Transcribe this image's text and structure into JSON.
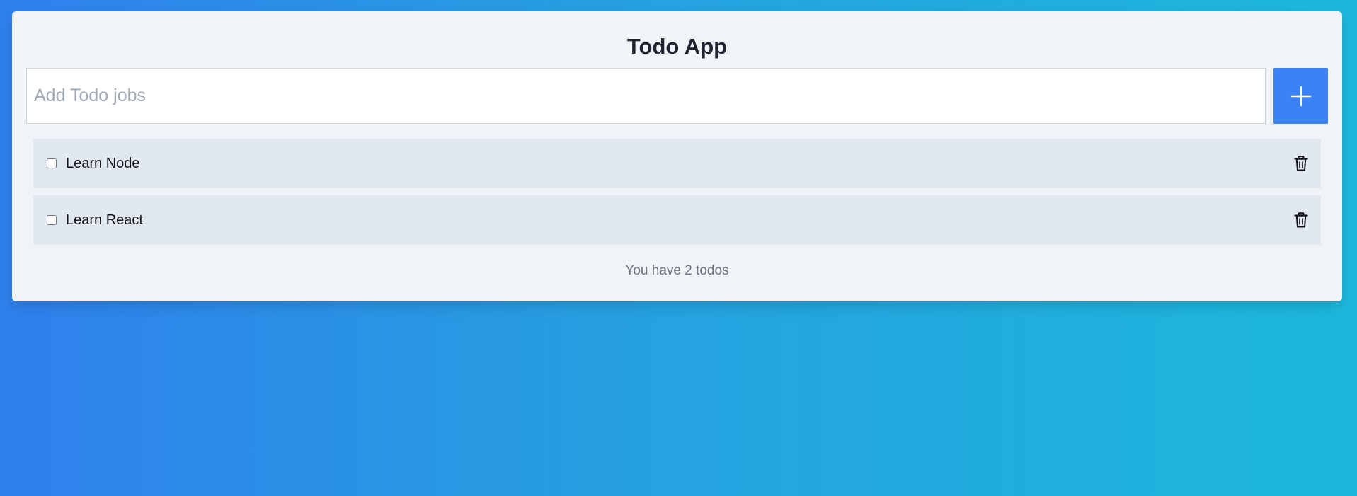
{
  "app": {
    "title": "Todo App"
  },
  "input": {
    "placeholder": "Add Todo jobs",
    "value": ""
  },
  "add_button": {
    "icon": "plus-icon",
    "color": "#3b82f6"
  },
  "todos": [
    {
      "label": "Learn Node",
      "checked": false,
      "delete_icon": "trash-icon"
    },
    {
      "label": "Learn React",
      "checked": false,
      "delete_icon": "trash-icon"
    }
  ],
  "footer": {
    "count_text": "You have 2 todos"
  },
  "colors": {
    "background_start": "#2f80ed",
    "background_end": "#1cb8dc",
    "card": "#f0f4f8",
    "item": "#e2e8f0",
    "accent": "#3b82f6"
  }
}
